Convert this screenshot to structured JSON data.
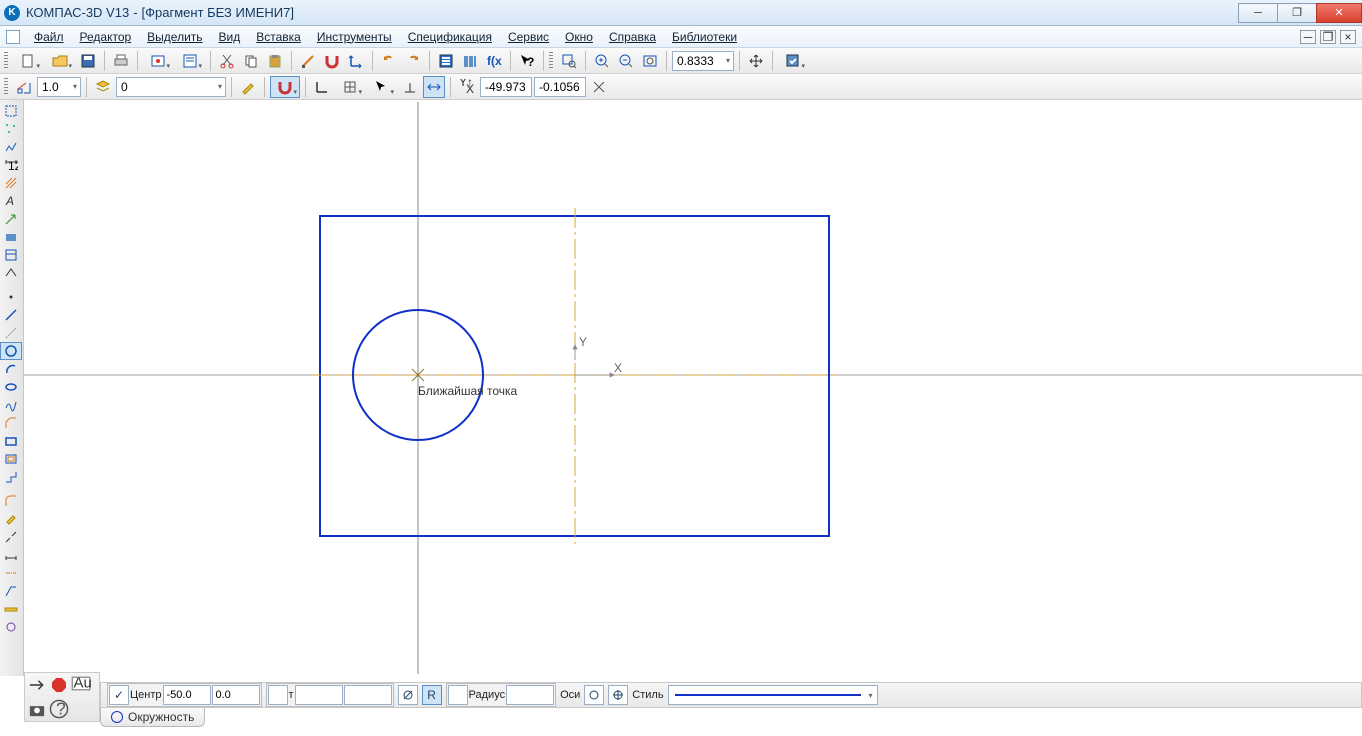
{
  "title": {
    "app": "КОМПАС-3D V13",
    "doc": "[Фрагмент БЕЗ ИМЕНИ7]"
  },
  "menu": {
    "file": "Файл",
    "edit": "Редактор",
    "select": "Выделить",
    "view": "Вид",
    "insert": "Вставка",
    "tools": "Инструменты",
    "spec": "Спецификация",
    "service": "Сервис",
    "window": "Окно",
    "help": "Справка",
    "libs": "Библиотеки"
  },
  "toolbar1": {
    "zoom_value": "0.8333"
  },
  "toolbar2": {
    "scale": "1.0",
    "layer": "0",
    "coord_x": "-49.973",
    "coord_y": "-0.1056"
  },
  "canvas": {
    "tooltip": "Ближайшая точка",
    "axis_x": "X",
    "axis_y": "Y"
  },
  "prop": {
    "center_label": "Центр",
    "center_x": "-50.0",
    "center_y": "0.0",
    "t_label": "т",
    "r_btn": "R",
    "radius_label": "Радиус",
    "axes_label": "Оси",
    "style_label": "Стиль",
    "check": "✓"
  },
  "tab": {
    "label": "Окружность"
  }
}
